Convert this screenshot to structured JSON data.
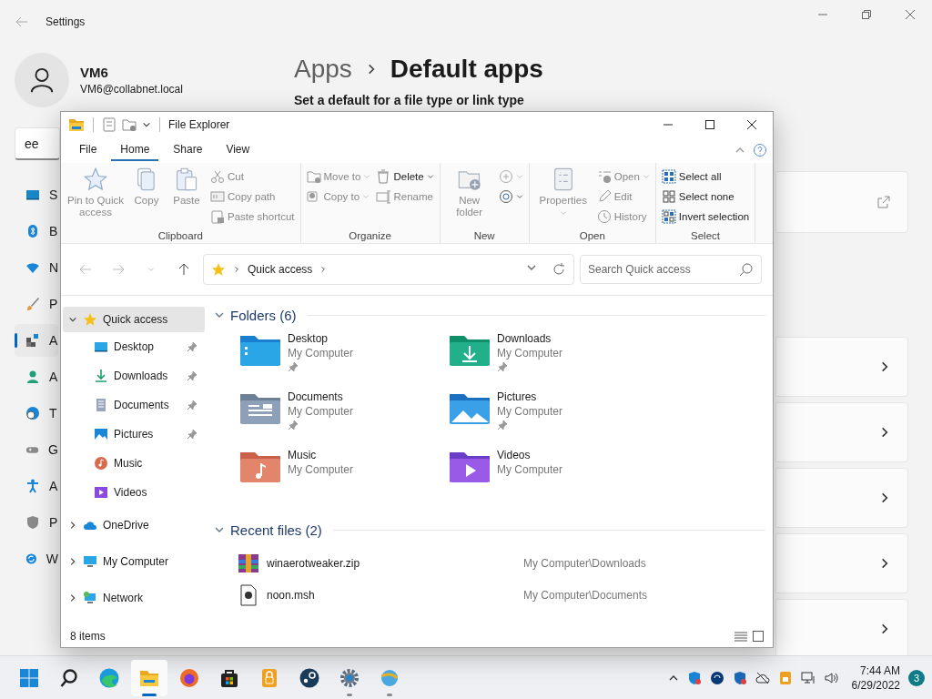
{
  "settings": {
    "title": "Settings",
    "user": {
      "name": "VM6",
      "email": "VM6@collabnet.local"
    },
    "search": {
      "value": "ee"
    },
    "nav": [
      {
        "label": "S",
        "selected": false
      },
      {
        "label": "B",
        "selected": false
      },
      {
        "label": "N",
        "selected": false
      },
      {
        "label": "P",
        "selected": false
      },
      {
        "label": "A",
        "selected": true
      },
      {
        "label": "A",
        "selected": false
      },
      {
        "label": "T",
        "selected": false
      },
      {
        "label": "G",
        "selected": false
      },
      {
        "label": "A",
        "selected": false
      },
      {
        "label": "P",
        "selected": false
      },
      {
        "label": "W",
        "selected": false
      }
    ],
    "breadcrumb": [
      "Apps",
      "Default apps"
    ],
    "subtitle": "Set a default for a file type or link type",
    "cards": [
      {
        "kind": "link"
      },
      {
        "kind": "chevron"
      },
      {
        "kind": "chevron"
      },
      {
        "kind": "chevron"
      },
      {
        "kind": "chevron"
      },
      {
        "kind": "chevron"
      }
    ]
  },
  "explorer": {
    "title": "File Explorer",
    "tabs": [
      {
        "label": "File",
        "selected": false
      },
      {
        "label": "Home",
        "selected": true
      },
      {
        "label": "Share",
        "selected": false
      },
      {
        "label": "View",
        "selected": false
      }
    ],
    "ribbon": [
      {
        "label": "Clipboard",
        "columns": [
          {
            "kind": "large",
            "items": [
              {
                "label": "Pin to Quick access",
                "disabled": true,
                "dropdown": false
              },
              {
                "label": "Copy",
                "disabled": true,
                "dropdown": false
              },
              {
                "label": "Paste",
                "disabled": true,
                "dropdown": false
              }
            ]
          },
          {
            "kind": "small",
            "items": [
              {
                "label": "Cut",
                "disabled": true,
                "dropdown": false
              },
              {
                "label": "Copy path",
                "disabled": true,
                "dropdown": false
              },
              {
                "label": "Paste shortcut",
                "disabled": true,
                "dropdown": false
              }
            ]
          }
        ]
      },
      {
        "label": "Organize",
        "columns": [
          {
            "kind": "small",
            "items": [
              {
                "label": "Move to",
                "disabled": true,
                "dropdown": true
              },
              {
                "label": "Copy to",
                "disabled": true,
                "dropdown": true
              }
            ]
          },
          {
            "kind": "small",
            "items": [
              {
                "label": "Delete",
                "disabled": false,
                "dropdown": true
              },
              {
                "label": "Rename",
                "disabled": true,
                "dropdown": false
              }
            ]
          }
        ]
      },
      {
        "label": "New",
        "columns": [
          {
            "kind": "large",
            "items": [
              {
                "label": "New folder",
                "disabled": true,
                "dropdown": false
              }
            ]
          },
          {
            "kind": "small",
            "items": [
              {
                "disabled": true,
                "dropdown": true
              },
              {
                "disabled": false,
                "dropdown": true
              }
            ]
          }
        ]
      },
      {
        "label": "Open",
        "columns": [
          {
            "kind": "large",
            "items": [
              {
                "label": "Properties",
                "disabled": true,
                "dropdown": true
              }
            ]
          },
          {
            "kind": "small",
            "items": [
              {
                "label": "Open",
                "disabled": true,
                "dropdown": true
              },
              {
                "label": "Edit",
                "disabled": true,
                "dropdown": false
              },
              {
                "label": "History",
                "disabled": true,
                "dropdown": false
              }
            ]
          }
        ]
      },
      {
        "label": "Select",
        "columns": [
          {
            "kind": "small",
            "items": [
              {
                "label": "Select all",
                "disabled": false,
                "dropdown": false
              },
              {
                "label": "Select none",
                "disabled": false,
                "dropdown": false
              },
              {
                "label": "Invert selection",
                "disabled": false,
                "dropdown": false
              }
            ]
          }
        ]
      }
    ],
    "address": [
      "Quick access"
    ],
    "search": {
      "placeholder": "Search Quick access"
    },
    "tree": [
      {
        "label": "Quick access",
        "expanded": true,
        "selected": true,
        "children": [
          {
            "label": "Desktop",
            "pinned": true,
            "selected": false
          },
          {
            "label": "Downloads",
            "pinned": true,
            "selected": false
          },
          {
            "label": "Documents",
            "pinned": true,
            "selected": false
          },
          {
            "label": "Pictures",
            "pinned": true,
            "selected": false
          },
          {
            "label": "Music",
            "pinned": false,
            "selected": false
          },
          {
            "label": "Videos",
            "pinned": false,
            "selected": false
          }
        ]
      },
      {
        "label": "OneDrive",
        "expanded": false,
        "selected": false
      },
      {
        "label": "My Computer",
        "expanded": false,
        "selected": false
      },
      {
        "label": "Network",
        "expanded": false,
        "selected": false
      }
    ],
    "folders": {
      "label": "Folders (6)",
      "expanded": true,
      "items": [
        {
          "name": "Desktop",
          "location": "My Computer",
          "pinned": true
        },
        {
          "name": "Downloads",
          "location": "My Computer",
          "pinned": true
        },
        {
          "name": "Documents",
          "location": "My Computer",
          "pinned": true
        },
        {
          "name": "Pictures",
          "location": "My Computer",
          "pinned": true
        },
        {
          "name": "Music",
          "location": "My Computer",
          "pinned": false
        },
        {
          "name": "Videos",
          "location": "My Computer",
          "pinned": false
        }
      ]
    },
    "recent": {
      "label": "Recent files (2)",
      "expanded": true,
      "items": [
        {
          "name": "winaerotweaker.zip",
          "path": "My Computer\\Downloads"
        },
        {
          "name": "noon.msh",
          "path": "My Computer\\Documents"
        }
      ]
    },
    "status": "8 items"
  },
  "taskbar": {
    "apps": [
      {
        "active": false,
        "running": false
      },
      {
        "active": false,
        "running": false
      },
      {
        "active": false,
        "running": false
      },
      {
        "active": true,
        "running": true
      },
      {
        "active": false,
        "running": false
      },
      {
        "active": false,
        "running": false
      },
      {
        "active": false,
        "running": false
      },
      {
        "active": false,
        "running": false
      },
      {
        "active": false,
        "running": true
      },
      {
        "active": false,
        "running": true
      }
    ],
    "time": "7:44 AM",
    "date": "6/29/2022",
    "badge": "3"
  }
}
